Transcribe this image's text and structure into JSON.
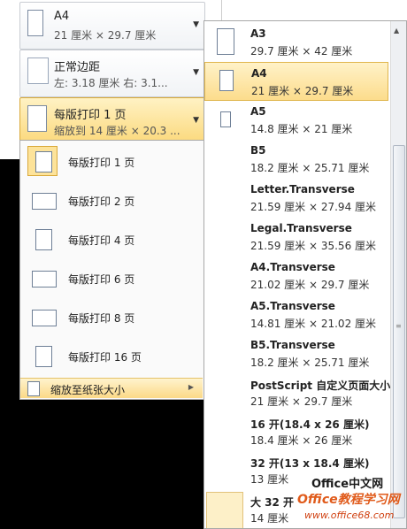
{
  "settings": {
    "paper": {
      "title": "A4",
      "sub": "21 厘米 × 29.7 厘米"
    },
    "margins": {
      "title": "正常边距",
      "sub": "左: 3.18 厘米     右: 3.1..."
    },
    "pages_per_sheet": {
      "title": "每版打印 1 页",
      "sub": "缩放到 14 厘米 × 20.3 ..."
    }
  },
  "pps_menu": {
    "items": [
      {
        "label": "每版打印 1 页",
        "selected": true
      },
      {
        "label": "每版打印 2 页"
      },
      {
        "label": "每版打印 4 页"
      },
      {
        "label": "每版打印 6 页"
      },
      {
        "label": "每版打印 8 页"
      },
      {
        "label": "每版打印 16 页"
      }
    ],
    "scale_label": "缩放至纸张大小"
  },
  "paper_menu": {
    "items": [
      {
        "name": "A3",
        "size": "29.7 厘米 × 42 厘米"
      },
      {
        "name": "A4",
        "size": "21 厘米 × 29.7 厘米",
        "selected": true
      },
      {
        "name": "A5",
        "size": "14.8 厘米 × 21 厘米"
      },
      {
        "name": "B5",
        "size": "18.2 厘米 × 25.71 厘米"
      },
      {
        "name": "Letter.Transverse",
        "size": "21.59 厘米 × 27.94 厘米"
      },
      {
        "name": "Legal.Transverse",
        "size": "21.59 厘米 × 35.56 厘米"
      },
      {
        "name": "A4.Transverse",
        "size": "21.02 厘米 × 29.7 厘米"
      },
      {
        "name": "A5.Transverse",
        "size": "14.81 厘米 × 21.02 厘米"
      },
      {
        "name": "B5.Transverse",
        "size": "18.2 厘米 × 25.71 厘米"
      },
      {
        "name": "PostScript 自定义页面大小",
        "size": "21 厘米 × 29.7 厘米"
      },
      {
        "name": "16 开(18.4 x 26 厘米)",
        "size": "18.4 厘米 × 26 厘米"
      },
      {
        "name": "32 开(13 x 18.4 厘米)",
        "size": "13 厘米"
      },
      {
        "name": "大 32 开",
        "size": "14 厘米"
      }
    ]
  },
  "watermark": {
    "line1": "Office中文网",
    "line2": "Office教程学习网",
    "line3": "www.office68.com"
  }
}
